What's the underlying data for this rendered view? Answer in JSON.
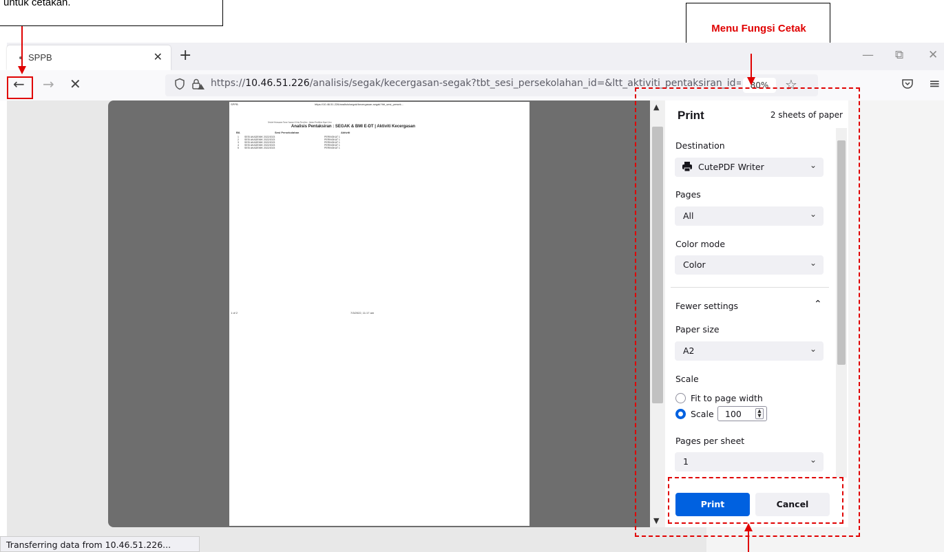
{
  "annotations": {
    "top_note": "untuk cetakan.",
    "menu_label": "Menu Fungsi Cetak",
    "accent_color": "#e00000"
  },
  "tab": {
    "title": "SPPB",
    "close_icon": "close-icon",
    "new_tab_icon": "plus-icon"
  },
  "window_controls": {
    "minimize": "—",
    "restore": "⧉",
    "close": "✕"
  },
  "nav": {
    "back": "←",
    "forward": "→",
    "stop": "✕",
    "url_prefix": "https://",
    "url_host": "10.46.51.226",
    "url_path": "/analisis/segak/kecergasan-segak?tbt_sesi_persekolahan_id=&ltt_aktiviti_pentaksiran_id=&id_jpn=&i...",
    "zoom": "80%",
    "pocket_icon": "pocket-icon",
    "menu_icon": "hamburger-icon"
  },
  "preview": {
    "header_left": "SPPB",
    "header_url": "https://10.46.51.226/analisis/segak/kecergasan-segak?tbt_sesi_persek...",
    "subhead": "Sekolah Kebangsaan Taman Yayasan & Kelas Pemulihan · Jabatan Pendidikan Negeri Johor",
    "title": "Analisis Pentaksiran : SEGAK & BMI E-DT | Aktiviti Kecergasan",
    "cols": [
      "Bil.",
      "Sesi Persekolahan",
      "Aktiviti"
    ],
    "rows": [
      [
        "1",
        "SESI AKADEMIK 2022/2023",
        "PERINGKAT 1"
      ],
      [
        "2",
        "SESI AKADEMIK 2022/2023",
        "PERINGKAT 1"
      ],
      [
        "3",
        "SESI AKADEMIK 2022/2023",
        "PERINGKAT 1"
      ],
      [
        "4",
        "SESI AKADEMIK 2022/2023",
        "PERINGKAT 1"
      ],
      [
        "5",
        "SESI AKADEMIK 2022/2023",
        "PERINGKAT 1"
      ]
    ],
    "footer_left": "1 of 2",
    "footer_right": "7/3/2022, 11:17 am"
  },
  "print_panel": {
    "title": "Print",
    "sheets": "2 sheets of paper",
    "destination_label": "Destination",
    "destination_value": "CutePDF Writer",
    "pages_label": "Pages",
    "pages_value": "All",
    "color_label": "Color mode",
    "color_value": "Color",
    "fewer_settings": "Fewer settings",
    "paper_label": "Paper size",
    "paper_value": "A2",
    "scale_label": "Scale",
    "fit_label": "Fit to page width",
    "scale_radio_label": "Scale",
    "scale_value": "100",
    "pps_label": "Pages per sheet",
    "pps_value": "1",
    "print_button": "Print",
    "cancel_button": "Cancel"
  },
  "status": {
    "text": "Transferring data from 10.46.51.226..."
  }
}
